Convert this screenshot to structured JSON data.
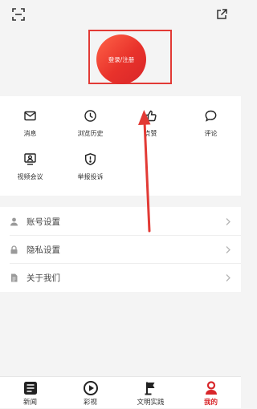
{
  "header": {
    "scan_icon": "scan-icon",
    "share_icon": "share-icon",
    "login_label": "登录/注册"
  },
  "features": [
    {
      "icon": "envelope-icon",
      "label": "消息"
    },
    {
      "icon": "clock-icon",
      "label": "浏览历史"
    },
    {
      "icon": "thumbs-up-icon",
      "label": "点赞"
    },
    {
      "icon": "comment-icon",
      "label": "评论"
    },
    {
      "icon": "video-conference-icon",
      "label": "视频会议"
    },
    {
      "icon": "report-icon",
      "label": "举报投诉"
    }
  ],
  "settings": [
    {
      "icon": "user-icon",
      "label": "账号设置"
    },
    {
      "icon": "lock-icon",
      "label": "隐私设置"
    },
    {
      "icon": "document-icon",
      "label": "关于我们"
    }
  ],
  "tabbar": {
    "items": [
      {
        "icon": "news-icon",
        "label": "新闻",
        "active": false
      },
      {
        "icon": "play-icon",
        "label": "彩视",
        "active": false
      },
      {
        "icon": "flag-icon",
        "label": "文明实践",
        "active": false
      },
      {
        "icon": "profile-icon",
        "label": "我的",
        "active": true
      }
    ]
  },
  "colors": {
    "accent": "#d8262a",
    "annotation": "#e23a35"
  }
}
